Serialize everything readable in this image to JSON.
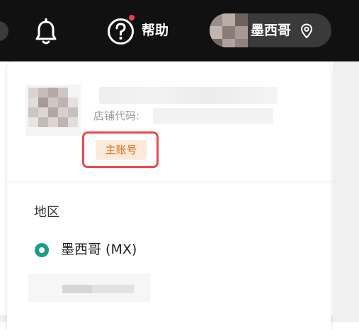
{
  "topbar": {
    "help_label": "帮助",
    "region_label": "墨西哥",
    "colors": {
      "background": "#111111",
      "help_dot": "#e8414c"
    },
    "icons": [
      "bell-icon",
      "help-circle-icon",
      "location-pin-icon"
    ]
  },
  "account_panel": {
    "store_code_label": "店铺代码:",
    "badge_label": "主账号",
    "colors": {
      "badge_text": "#e56b1f",
      "badge_bg": "#fbead9",
      "highlight_box": "#e84a4a"
    }
  },
  "region_section": {
    "heading": "地区",
    "selected_option": "墨西哥 (MX)",
    "colors": {
      "radio": "#1a9e8a"
    }
  }
}
